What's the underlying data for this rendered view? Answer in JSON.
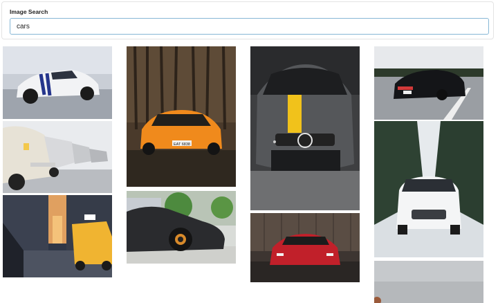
{
  "search": {
    "label": "Image Search",
    "value": "cars"
  },
  "results": [
    {
      "id": "r1",
      "subject": "white sports car with blue racing stripes"
    },
    {
      "id": "r2",
      "subject": "row of vintage cars parked"
    },
    {
      "id": "r3",
      "subject": "city street at sunset with yellow taxi"
    },
    {
      "id": "r4",
      "subject": "orange supercar in forest",
      "plate_text": "EAT 6838"
    },
    {
      "id": "r5",
      "subject": "black supercar side view"
    },
    {
      "id": "r6",
      "subject": "grey sports sedan with yellow stripe"
    },
    {
      "id": "r7",
      "subject": "red supercar front view"
    },
    {
      "id": "r8",
      "subject": "black sports car on highway"
    },
    {
      "id": "r9",
      "subject": "white SUV on snowy forest road"
    },
    {
      "id": "r10",
      "subject": "partially visible image"
    }
  ]
}
